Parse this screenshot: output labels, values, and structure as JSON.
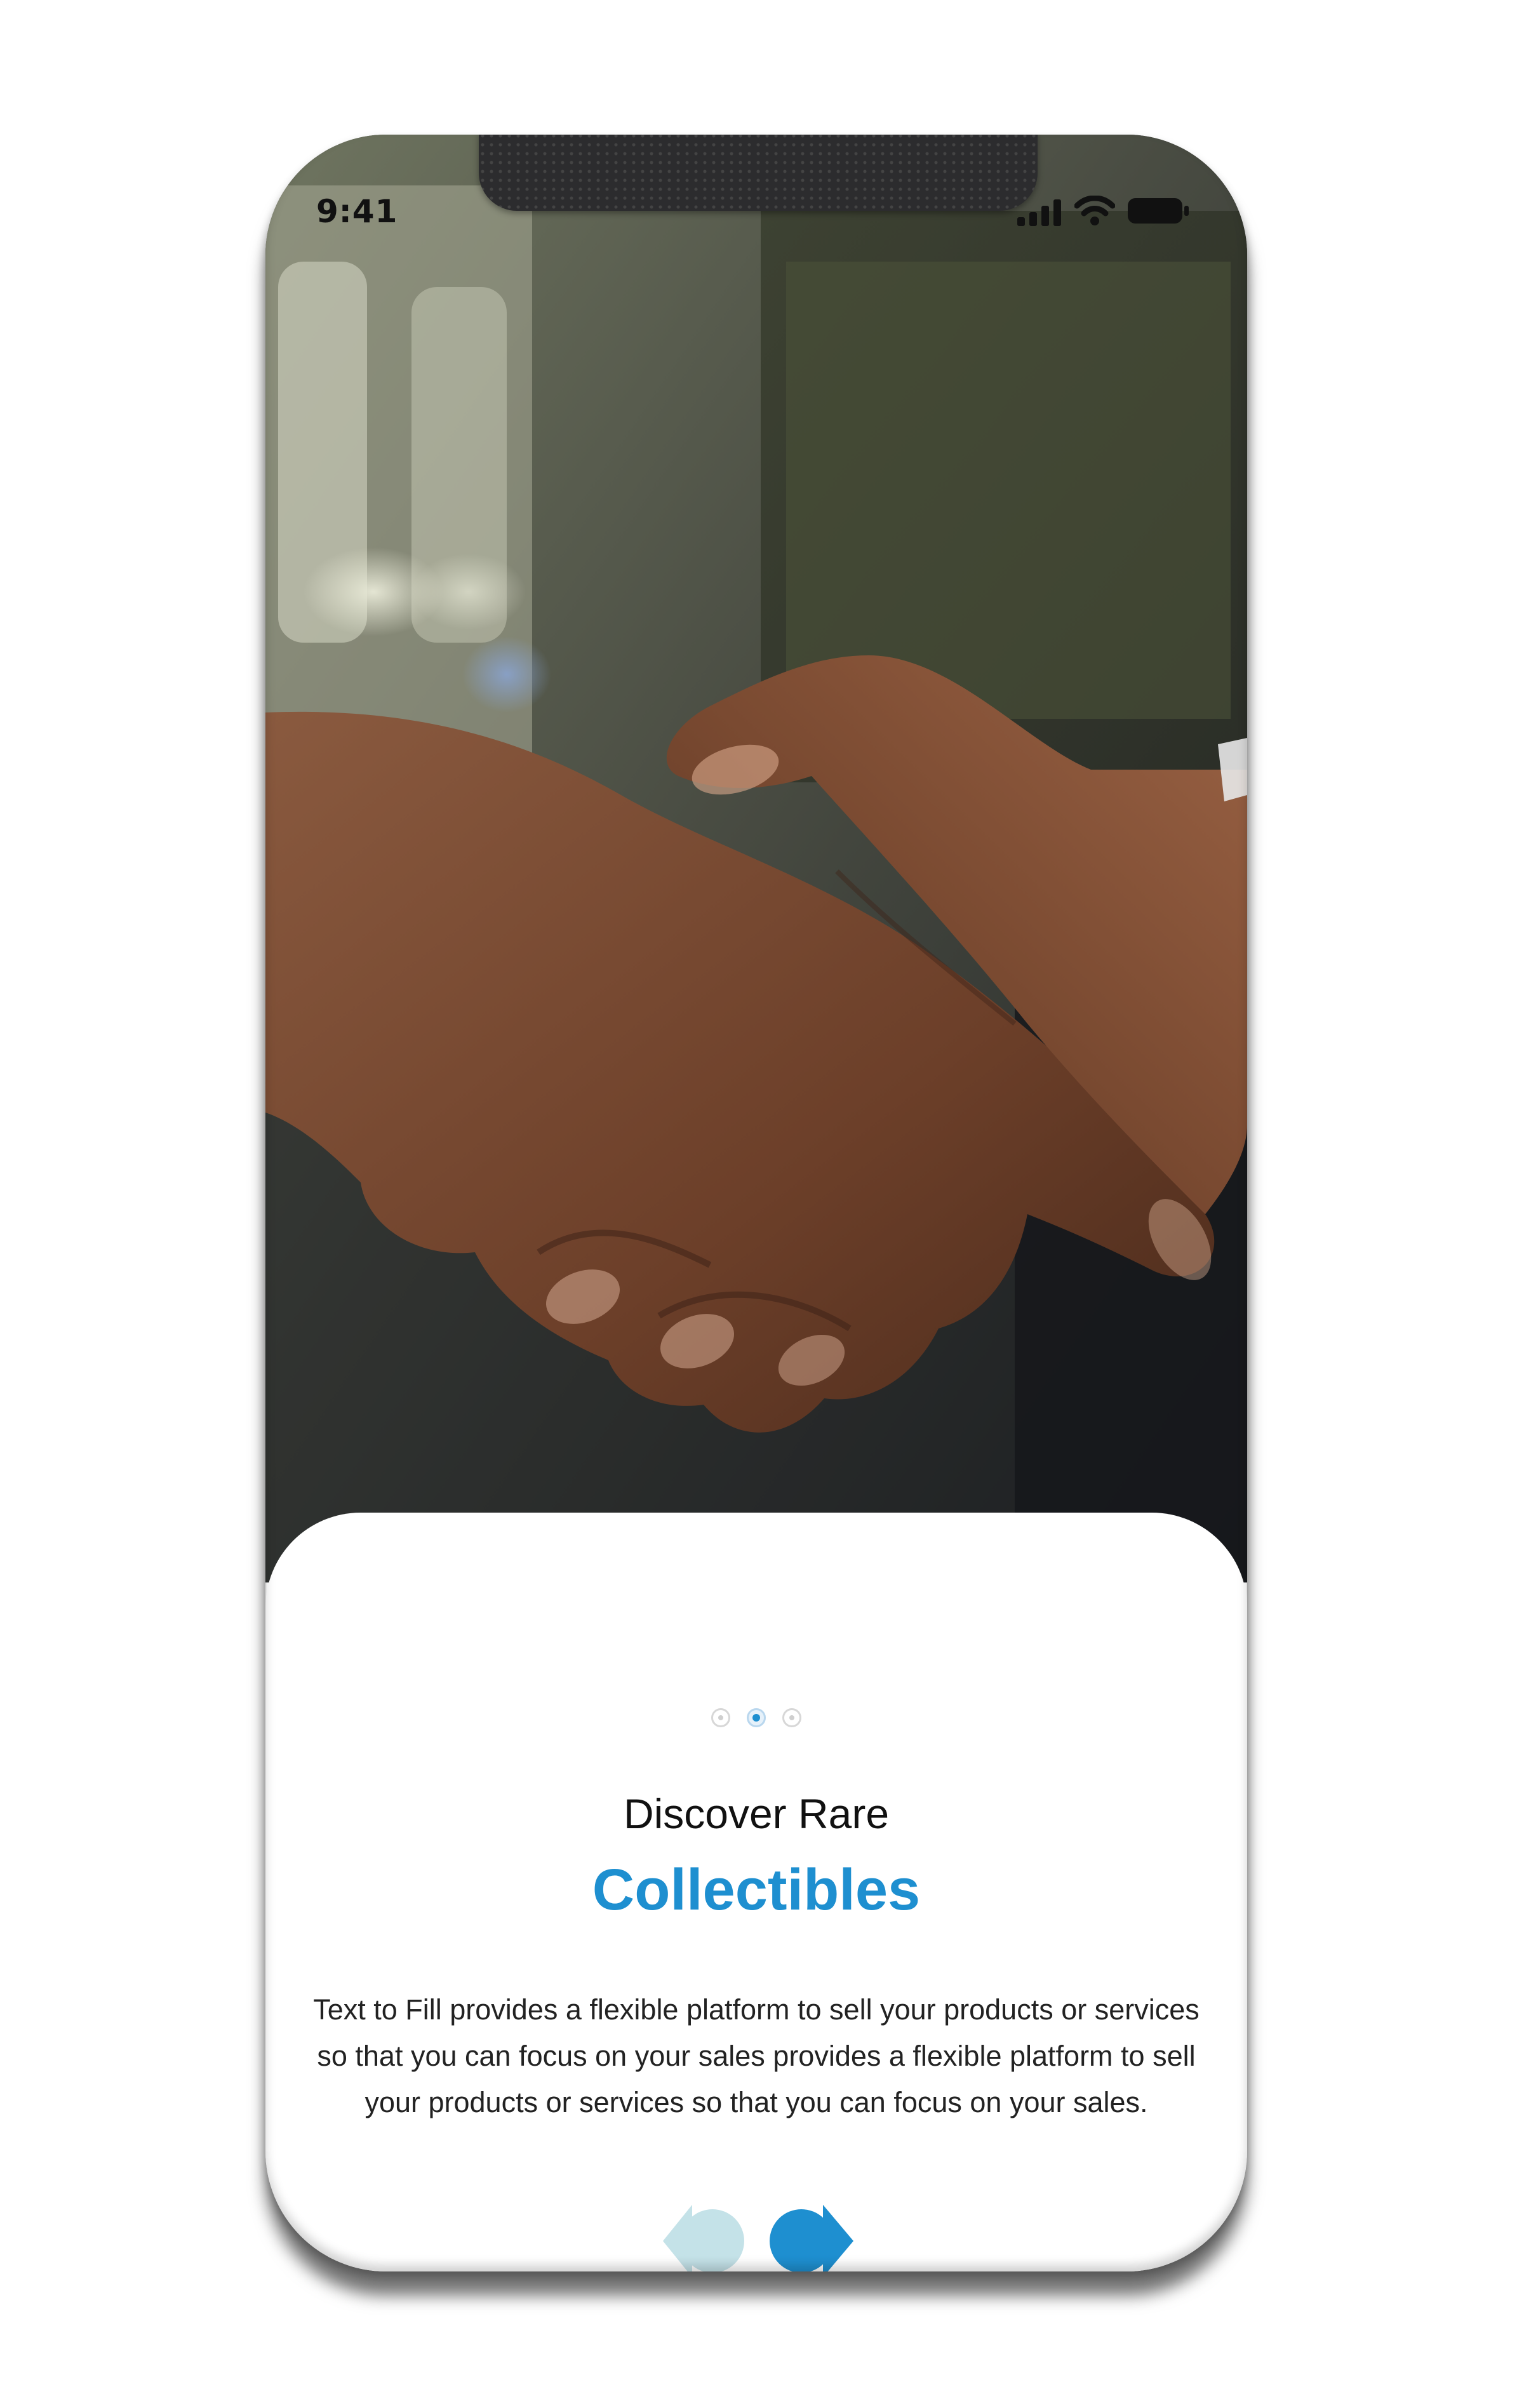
{
  "status_bar": {
    "time": "9:41",
    "icons": [
      "signal-icon",
      "wifi-icon",
      "battery-icon"
    ]
  },
  "hero_image": {
    "subject": "handshake photo"
  },
  "pagination": {
    "total": 3,
    "active_index": 1
  },
  "onboarding": {
    "subtitle": "Discover Rare",
    "title": "Collectibles",
    "description": "Text to Fill provides a flexible platform to sell your products or services so that you can focus on your sales provides a flexible platform to sell your products or services so that you can focus on your sales."
  },
  "navigation": {
    "prev_icon": "chevron-left-icon",
    "next_icon": "chevron-right-icon"
  },
  "colors": {
    "accent": "#1E8FD0",
    "accent_light": "#C4E2E8",
    "text": "#111111"
  }
}
